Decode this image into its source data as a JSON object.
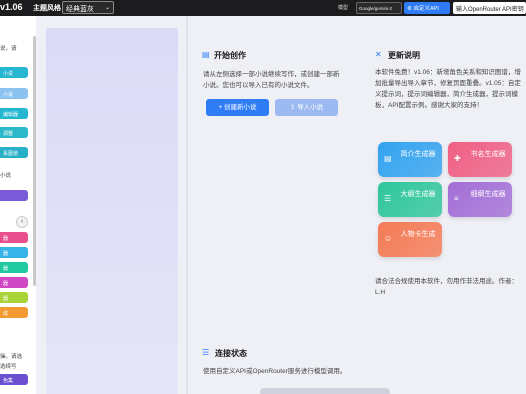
{
  "topbar": {
    "version": "v1.06",
    "theme_label": "主题风格",
    "theme_value": "经典蓝灰",
    "model_label": "模型",
    "model_value": "Google/gemini-2",
    "custom_api_label": "自定义API",
    "openrouter_label": "输入OpenRouter API密钥"
  },
  "sidebar": {
    "texts": [
      "说，请",
      "小说",
      "操。请选",
      "选续写"
    ],
    "buttons": [
      {
        "label": "小说",
        "color": "#25b6d2"
      },
      {
        "label": "小说",
        "color": "#8cc2f0"
      },
      {
        "label": "编辑器",
        "color": "#25b6d2"
      },
      {
        "label": "调整",
        "color": "#2bb8c9"
      },
      {
        "label": "系图谱",
        "color": "#27b0c8"
      },
      {
        "label": "",
        "color": "#7a5ad6"
      },
      {
        "label": "器",
        "color": "#e8508d"
      },
      {
        "label": "器",
        "color": "#36b3e7"
      },
      {
        "label": "器",
        "color": "#20c9a0"
      },
      {
        "label": "器",
        "color": "#d048c4"
      },
      {
        "label": "器",
        "color": "#a8d43a"
      },
      {
        "label": "成",
        "color": "#f39b32"
      },
      {
        "label": "色集",
        "color": "#6b4fd1"
      }
    ]
  },
  "start": {
    "title": "开始创作",
    "desc": "请从左侧选择一部小说继续写作，或创建一部新小说。您也可以导入已有的小说文件。",
    "create_label": "+ 创建新小说",
    "import_label": "导入小说"
  },
  "update": {
    "title": "更新说明",
    "desc": "本软件免费！v1.06：新增角色关系和知识图谱，增加批量导出导入章节，修复页面重叠。v1.05：自定义提示词，提示词编辑器，简介生成器，提示词模板，API配置示例。感谢大家的支持！",
    "notice": "请合法合规使用本软件，勿用作非法用途。作者：L.H"
  },
  "tiles": [
    {
      "label": "简介生成器",
      "icon": "document-icon",
      "glyph": "▤",
      "color": "#33a3ef"
    },
    {
      "label": "书名生成器",
      "icon": "bookmark-icon",
      "glyph": "✚",
      "color": "#ef5f84"
    },
    {
      "label": "大纲生成器",
      "icon": "list-icon",
      "glyph": "☰",
      "color": "#2ec69a"
    },
    {
      "label": "细纲生成器",
      "icon": "indent-icon",
      "glyph": "≡",
      "color": "#a36ed6"
    },
    {
      "label": "人物卡生成",
      "icon": "person-icon",
      "glyph": "☺",
      "color": "#f57a55"
    }
  ],
  "connection": {
    "title": "连接状态",
    "desc": "使用自定义API或OpenRouter服务进行模型调用。"
  }
}
